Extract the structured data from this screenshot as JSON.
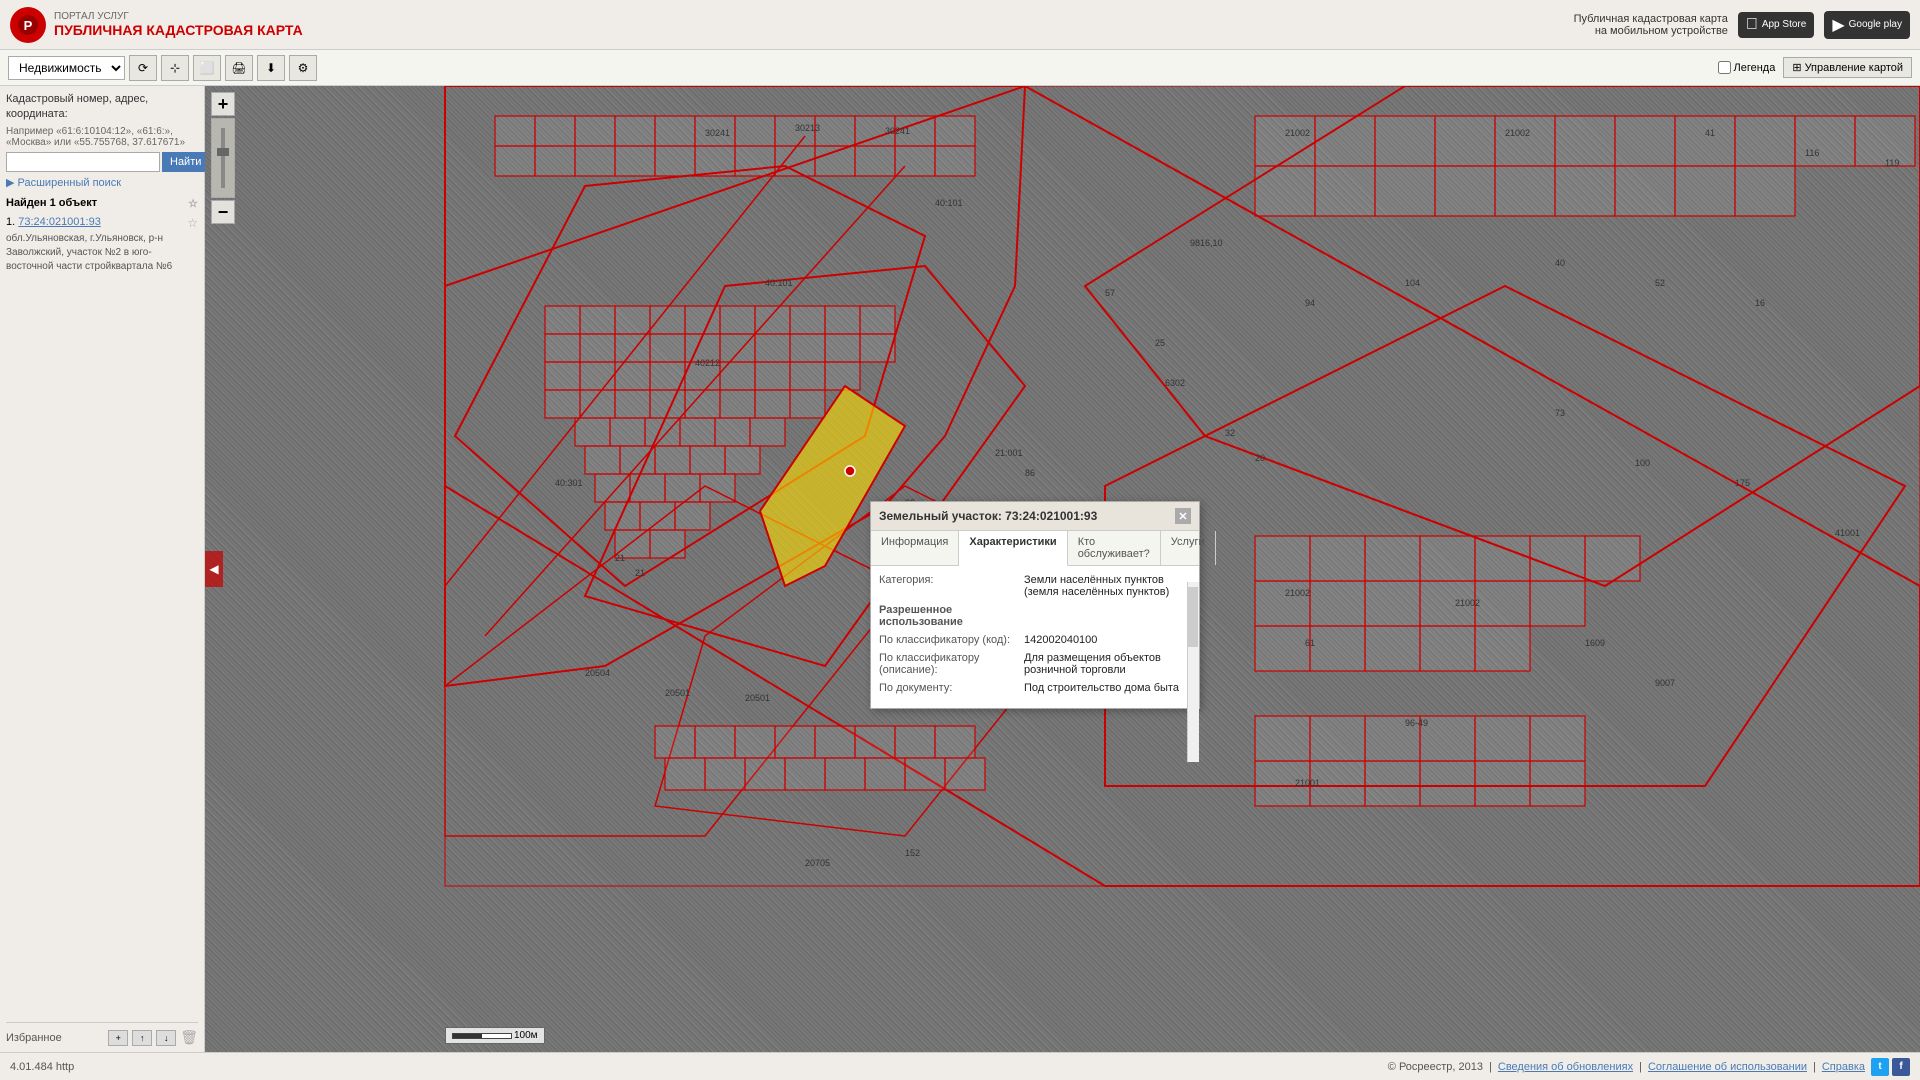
{
  "header": {
    "portal_label": "ПОРТАЛ УСЛУГ",
    "map_title": "ПУБЛИЧНАЯ КАДАСТРОВАЯ КАРТА",
    "mobile_label": "Публичная кадастровая карта\nна мобильном устройстве",
    "app_store_label": "App Store",
    "google_play_label": "Google play"
  },
  "toolbar": {
    "property_select": "Недвижимость",
    "legend_label": "Легенда",
    "manage_map_label": "Управление картой"
  },
  "search": {
    "label": "Кадастровый номер, адрес, координата:",
    "example": "Например «61:6:10104:12», «61:6:»,\n«Москва» или «55.755768, 37.617671»",
    "placeholder": "",
    "button_label": "Найти",
    "advanced_link": "▶ Расширенный поиск"
  },
  "results": {
    "header": "Найден 1 объект",
    "items": [
      {
        "number": "1.",
        "id": "73:24:021001:93",
        "address": "обл.Ульяновская, г.Ульяновск, р-н Заволжский, участок №2 в юго-восточной части стройквартала №6"
      }
    ]
  },
  "favorites": {
    "label": "Избранное"
  },
  "popup": {
    "title": "Земельный участок: 73:24:021001:93",
    "tabs": [
      "Информация",
      "Характеристики",
      "Кто обслуживает?",
      "Услуги"
    ],
    "active_tab": "Характеристики",
    "category_label": "Категория:",
    "category_value": "Земли населённых пунктов (земля населённых пунктов)",
    "permitted_use_label": "Разрешенное использование",
    "classifier_code_label": "По классификатору (код):",
    "classifier_code_value": "142002040100",
    "classifier_desc_label": "По классификатору (описание):",
    "classifier_desc_value": "Для размещения объектов розничной торговли",
    "document_label": "По документу:",
    "document_value": "Под строительство дома быта"
  },
  "footer": {
    "coords": "4.01.484 http",
    "copyright": "© Росреестр, 2013",
    "update_link": "Сведения об обновлениях",
    "terms_link": "Соглашение об использовании",
    "help_link": "Справка"
  },
  "map_controls": {
    "zoom_in": "+",
    "zoom_out": "−",
    "nav_arrow": "◀"
  }
}
